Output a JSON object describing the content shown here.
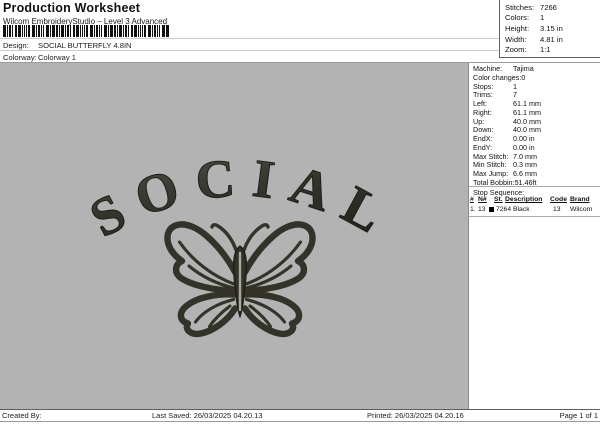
{
  "header": {
    "title": "Production Worksheet",
    "subtitle": "Wilcom EmbroideryStudio – Level 3 Advanced",
    "design_label": "Design:",
    "design_value": "SOCIAL BUTTERFLY 4.8IN",
    "colorway_label": "Colorway:",
    "colorway_value": "Colorway 1"
  },
  "summary_box": {
    "rows": [
      {
        "label": "Stitches:",
        "value": "7266"
      },
      {
        "label": "Colors:",
        "value": "1"
      },
      {
        "label": "Height:",
        "value": "3.15 in"
      },
      {
        "label": "Width:",
        "value": "4.81 in"
      },
      {
        "label": "Zoom:",
        "value": "1:1"
      }
    ]
  },
  "machine_info": {
    "rows": [
      {
        "label": "Machine:",
        "value": "Tajima"
      },
      {
        "label": "Color changes:",
        "value": "0"
      },
      {
        "label": "Stops:",
        "value": "1"
      },
      {
        "label": "Trims:",
        "value": "7"
      },
      {
        "label": "Left:",
        "value": "61.1 mm"
      },
      {
        "label": "Right:",
        "value": "61.1 mm"
      },
      {
        "label": "Up:",
        "value": "40.0 mm"
      },
      {
        "label": "Down:",
        "value": "40.0 mm"
      },
      {
        "label": "EndX:",
        "value": "0.00 in"
      },
      {
        "label": "EndY:",
        "value": "0.00 in"
      },
      {
        "label": "Max Stitch:",
        "value": "7.0 mm"
      },
      {
        "label": "Min Stitch:",
        "value": "0.3 mm"
      },
      {
        "label": "Max Jump:",
        "value": "6.6 mm"
      },
      {
        "label": "Total Bobbin:",
        "value": "51.46ft"
      }
    ]
  },
  "stop_sequence": {
    "title": "Stop Sequence:",
    "columns": {
      "num": "#",
      "needle": "N#",
      "st": "St.",
      "description": "Description",
      "code": "Code",
      "brand": "Brand"
    },
    "row": {
      "num": "1.",
      "needle": "13",
      "swatch_color": "#000000",
      "st": "7264",
      "description": "Black",
      "code": "13",
      "brand": "Wilcom"
    }
  },
  "design_preview": {
    "text": "SOCIAL",
    "motif": "butterfly-outline",
    "thread_color": "#33332a",
    "canvas_color": "#b3b3b3"
  },
  "footer": {
    "created_by": "Created By:",
    "last_saved": "Last Saved: 26/03/2025 04.20.13",
    "printed": "Printed: 26/03/2025 04.20.16",
    "page": "Page 1 of 1"
  },
  "barcode": {
    "bars": [
      [
        3,
        1
      ],
      [
        1,
        1
      ],
      [
        2,
        1
      ],
      [
        1,
        2
      ],
      [
        2,
        1
      ],
      [
        3,
        1
      ],
      [
        1,
        1
      ],
      [
        1,
        1
      ],
      [
        1,
        1
      ],
      [
        2,
        2
      ],
      [
        3,
        1
      ],
      [
        1,
        1
      ],
      [
        2,
        1
      ],
      [
        1,
        1
      ],
      [
        1,
        2
      ],
      [
        3,
        1
      ],
      [
        1,
        1
      ],
      [
        3,
        1
      ],
      [
        2,
        1
      ],
      [
        1,
        1
      ],
      [
        3,
        1
      ],
      [
        1,
        1
      ],
      [
        2,
        1
      ],
      [
        1,
        2
      ],
      [
        2,
        1
      ],
      [
        3,
        1
      ],
      [
        1,
        1
      ],
      [
        1,
        1
      ],
      [
        1,
        1
      ],
      [
        2,
        2
      ],
      [
        3,
        1
      ],
      [
        1,
        1
      ],
      [
        2,
        1
      ],
      [
        1,
        1
      ],
      [
        1,
        2
      ],
      [
        3,
        1
      ],
      [
        1,
        1
      ],
      [
        3,
        1
      ],
      [
        2,
        1
      ],
      [
        1,
        1
      ],
      [
        3,
        1
      ],
      [
        1,
        1
      ],
      [
        2,
        1
      ],
      [
        1,
        2
      ],
      [
        2,
        1
      ],
      [
        3,
        1
      ],
      [
        1,
        1
      ],
      [
        1,
        1
      ],
      [
        1,
        1
      ],
      [
        2,
        2
      ],
      [
        3,
        1
      ],
      [
        1,
        1
      ],
      [
        2,
        1
      ],
      [
        1,
        1
      ],
      [
        1,
        2
      ],
      [
        3,
        1
      ],
      [
        3,
        0
      ]
    ]
  }
}
